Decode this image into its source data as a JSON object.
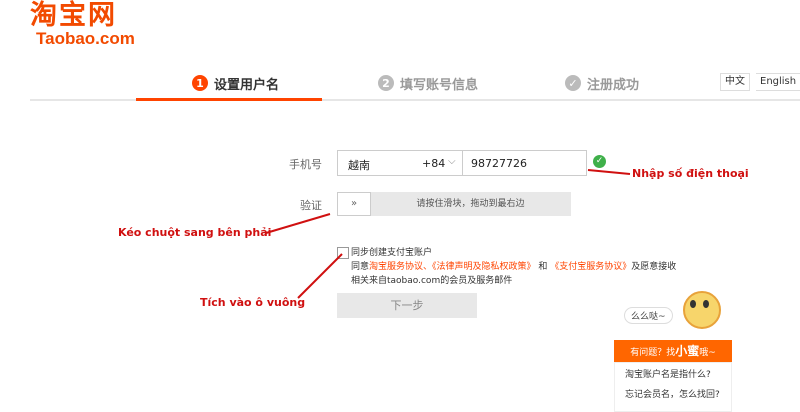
{
  "logo": {
    "cn": "淘宝网",
    "en": "Taobao.com"
  },
  "steps": [
    {
      "num": "1",
      "label": "设置用户名"
    },
    {
      "num": "2",
      "label": "填写账号信息"
    },
    {
      "num": "✓",
      "label": "注册成功"
    }
  ],
  "lang": {
    "cn": "中文",
    "en": "English"
  },
  "form": {
    "phone_label": "手机号",
    "country": "越南",
    "country_code": "+84",
    "phone_value": "98727726",
    "verify_label": "验证",
    "slider_handle": "»",
    "slider_text": "请按住滑块，拖动到最右边",
    "agree_line1": "同步创建支付宝账户",
    "agree_prefix": "同意",
    "agree_link1": "淘宝服务协议、《法律声明及隐私权政策》",
    "agree_and": " 和 ",
    "agree_link2": "《支付宝服务协议》",
    "agree_suffix": "及愿意接收",
    "agree_line3": "相关来自taobao.com的会员及服务邮件",
    "next_button": "下一步"
  },
  "annotations": {
    "phone": "Nhập số điện thoại",
    "slider": "Kéo chuột sang bên phải",
    "checkbox": "Tích vào ô vuông"
  },
  "help": {
    "bubble": "么么哒~",
    "head_prefix": "有问题？找",
    "head_name": "小蜜",
    "head_suffix": "哦~",
    "q1": "淘宝账户名是指什么?",
    "q2": "忘记会员名，怎么找回?"
  },
  "colors": {
    "accent": "#ff4400",
    "success": "#3fb04a",
    "annotation": "#d01010"
  },
  "icons": {
    "check": "check-circle-icon",
    "chevron": "chevron-down-icon",
    "slider": "double-chevron-right-icon"
  }
}
